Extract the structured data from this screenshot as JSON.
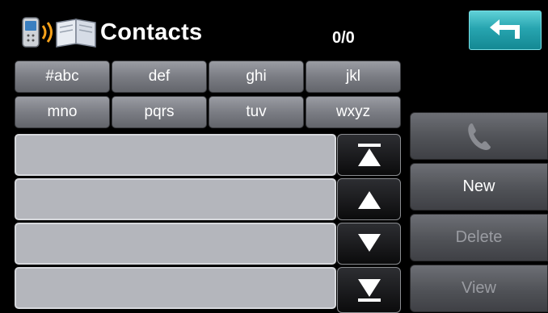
{
  "header": {
    "title": "Contacts",
    "count": "0/0",
    "back_icon": "back-arrow-icon",
    "app_icon": "phone-contacts-icon"
  },
  "filter_tabs": [
    "#abc",
    "def",
    "ghi",
    "jkl",
    "mno",
    "pqrs",
    "tuv",
    "wxyz"
  ],
  "contact_rows": [
    "",
    "",
    "",
    ""
  ],
  "scroll_buttons": [
    "scroll-top-icon",
    "scroll-up-icon",
    "scroll-down-icon",
    "scroll-bottom-icon"
  ],
  "actions": {
    "call_icon": "phone-handset-icon",
    "new_label": "New",
    "delete_label": "Delete",
    "view_label": "View"
  },
  "colors": {
    "accent": "#27a5b0",
    "background": "#000000",
    "row": "#b4b6bc"
  }
}
